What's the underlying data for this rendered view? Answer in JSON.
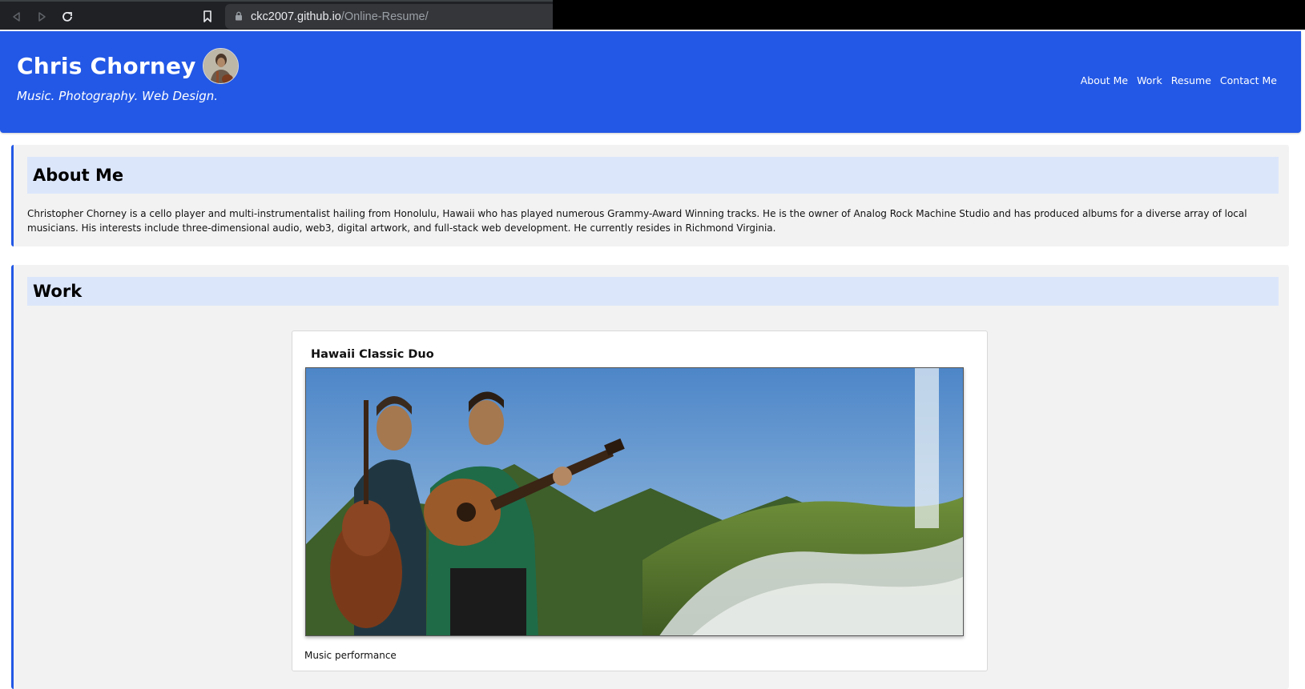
{
  "browser": {
    "url_host": "ckc2007.github.io",
    "url_path": "/Online-Resume/",
    "back_icon": "back-arrow-icon",
    "forward_icon": "forward-arrow-icon",
    "reload_icon": "reload-icon",
    "bookmark_icon": "bookmark-icon",
    "lock_icon": "lock-icon"
  },
  "header": {
    "name": "Chris Chorney",
    "tagline": "Music. Photography. Web Design.",
    "accent_color": "#2358e6",
    "nav": [
      {
        "label": "About Me"
      },
      {
        "label": "Work"
      },
      {
        "label": "Resume"
      },
      {
        "label": "Contact Me"
      }
    ]
  },
  "about": {
    "title": "About Me",
    "text": "Christopher Chorney is a cello player and multi-instrumentalist hailing from Honolulu, Hawaii who has played numerous Grammy-Award Winning tracks. He is the owner of Analog Rock Machine Studio and has produced albums for a diverse array of local musicians. His interests include three-dimensional audio, web3, digital artwork, and full-stack web development. He currently resides in Richmond Virginia."
  },
  "work": {
    "title": "Work",
    "card": {
      "title": "Hawaii Classic Duo",
      "caption": "Music performance"
    }
  }
}
